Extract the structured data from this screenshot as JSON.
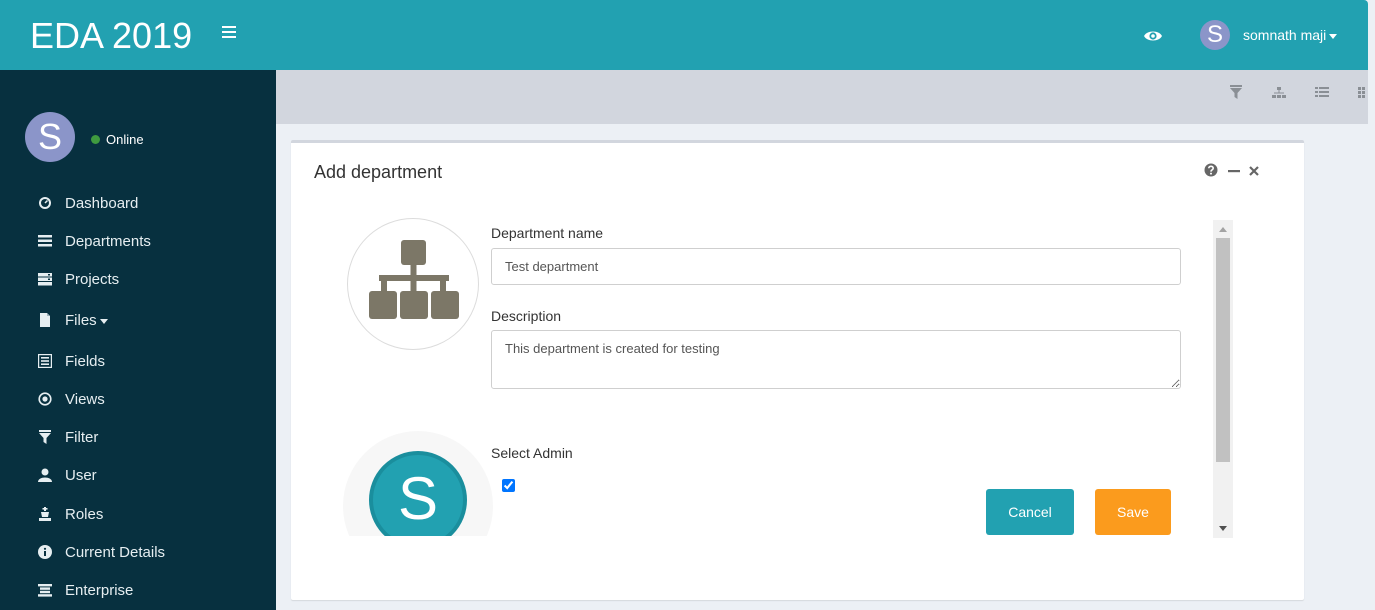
{
  "header": {
    "brand": "EDA 2019",
    "user_initial": "S",
    "user_name": "somnath maji"
  },
  "sidebar": {
    "avatar_initial": "S",
    "status": "Online",
    "status_color": "#3f9a3f",
    "items": [
      {
        "label": "Dashboard",
        "icon": "dashboard-icon"
      },
      {
        "label": "Departments",
        "icon": "list-icon"
      },
      {
        "label": "Projects",
        "icon": "server-icon"
      },
      {
        "label": "Files",
        "icon": "file-icon",
        "has_caret": true
      },
      {
        "label": "Fields",
        "icon": "list-alt-icon"
      },
      {
        "label": "Views",
        "icon": "record-icon"
      },
      {
        "label": "Filter",
        "icon": "filter-icon"
      },
      {
        "label": "User",
        "icon": "user-icon"
      },
      {
        "label": "Roles",
        "icon": "chess-king-icon"
      },
      {
        "label": "Current Details",
        "icon": "info-icon"
      },
      {
        "label": "Enterprise",
        "icon": "enterprise-icon"
      }
    ]
  },
  "toolbar": {
    "icons": [
      "filter-icon",
      "sitemap-icon",
      "list-view-icon",
      "grid-view-icon"
    ]
  },
  "form": {
    "title": "Add department",
    "department_name_label": "Department name",
    "department_name_value": "Test department",
    "description_label": "Description",
    "description_value": "This department is created for testing",
    "select_admin_label": "Select Admin",
    "admin_initial": "S",
    "admin_checked": true,
    "cancel_label": "Cancel",
    "save_label": "Save"
  },
  "colors": {
    "brand": "#22a1b1",
    "sidebar_bg": "#07303f",
    "save": "#fb9b1d"
  }
}
